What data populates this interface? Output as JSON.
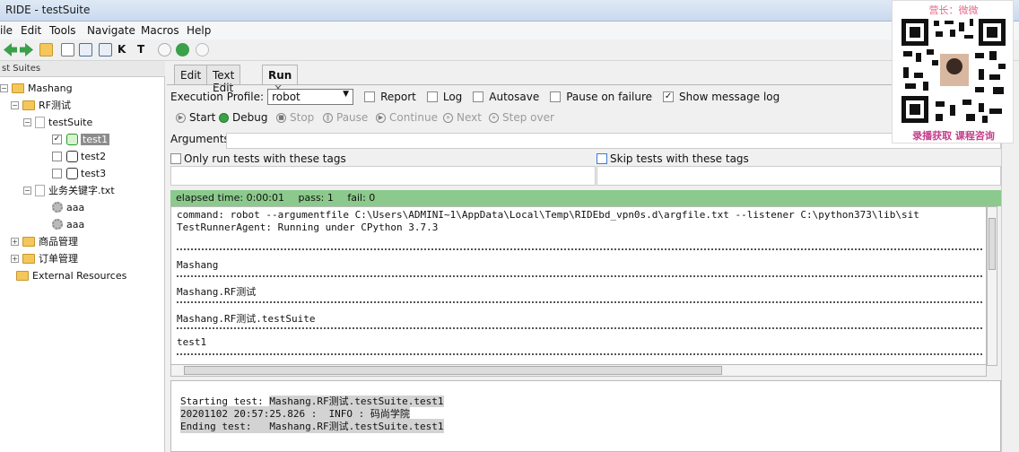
{
  "window": {
    "title": "RIDE - testSuite"
  },
  "menu": [
    "ile",
    "Edit",
    "Tools",
    "Navigate",
    "Macros",
    "Help"
  ],
  "toolbar_icons": [
    "back-arrow-icon",
    "forward-arrow-icon",
    "open-folder-icon",
    "open-file-icon",
    "save-icon",
    "save-all-icon",
    "keyword-search-icon",
    "test-search-icon",
    "play-icon",
    "debug-bug-icon",
    "stop-icon"
  ],
  "tree": {
    "header": "st Suites",
    "nodes": [
      {
        "label": "Mashang",
        "level": 0
      },
      {
        "label": "RF测试",
        "level": 1
      },
      {
        "label": "testSuite",
        "level": 2
      },
      {
        "label": "test1",
        "level": 3,
        "checked": true,
        "selected": true
      },
      {
        "label": "test2",
        "level": 3,
        "checked": false
      },
      {
        "label": "test3",
        "level": 3,
        "checked": false
      },
      {
        "label": "业务关键字.txt",
        "level": 2
      },
      {
        "label": "aaa",
        "level": 3
      },
      {
        "label": "aaa",
        "level": 3
      },
      {
        "label": "商品管理",
        "level": 1
      },
      {
        "label": "订单管理",
        "level": 1
      },
      {
        "label": "External Resources",
        "level": 0
      }
    ]
  },
  "tabs": [
    {
      "label": "Edit"
    },
    {
      "label": "Text Edit"
    },
    {
      "label": "Run",
      "active": true,
      "close": "×"
    }
  ],
  "run": {
    "profile_label": "Execution Profile:",
    "profile_value": "robot",
    "options": [
      {
        "label": "Report",
        "checked": false
      },
      {
        "label": "Log",
        "checked": false
      },
      {
        "label": "Autosave",
        "checked": false
      },
      {
        "label": "Pause on failure",
        "checked": false
      },
      {
        "label": "Show message log",
        "checked": true
      }
    ],
    "buttons": [
      {
        "label": "Start",
        "enabled": true
      },
      {
        "label": "Debug",
        "enabled": true
      },
      {
        "label": "Stop",
        "enabled": false
      },
      {
        "label": "Pause",
        "enabled": false
      },
      {
        "label": "Continue",
        "enabled": false
      },
      {
        "label": "Next",
        "enabled": false
      },
      {
        "label": "Step over",
        "enabled": false
      }
    ],
    "arguments_label": "Arguments:",
    "only_run_label": "Only run tests with these tags",
    "skip_label": "Skip tests with these tags",
    "status": {
      "elapsed": "elapsed time: 0:00:01",
      "pass": "pass: 1",
      "fail": "fail: 0"
    },
    "console_lines": [
      "command: robot --argumentfile C:\\Users\\ADMINI~1\\AppData\\Local\\Temp\\RIDEbd_vpn0s.d\\argfile.txt --listener C:\\python373\\lib\\sit",
      "TestRunnerAgent: Running under CPython 3.7.3",
      "Mashang",
      "Mashang.RF测试",
      "Mashang.RF测试.testSuite",
      "test1"
    ],
    "message_log": {
      "line1_prefix": "Starting test: ",
      "line1_value": "Mashang.RF测试.testSuite.test1",
      "line2": "20201102 20:57:25.826 :  INFO : 码尚学院",
      "line3": "Ending test:   Mashang.RF测试.testSuite.test1"
    }
  },
  "overlay": {
    "top_caption": "营长：微微",
    "bottom_caption": "录播获取 课程咨询"
  }
}
